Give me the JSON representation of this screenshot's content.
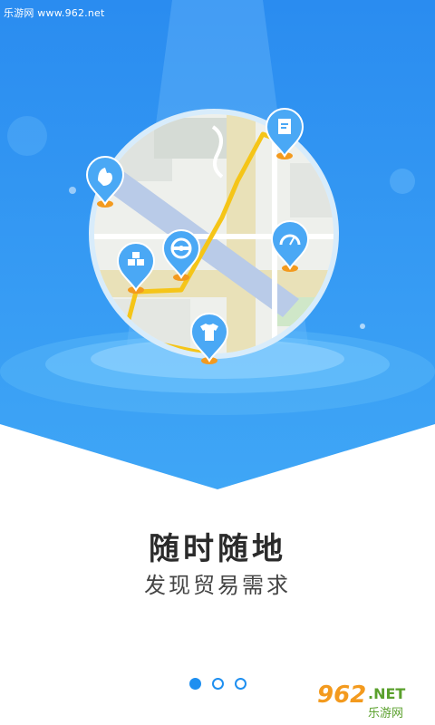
{
  "watermark": {
    "text": "乐游网 www.962.net"
  },
  "slide": {
    "title": "随时随地",
    "subtitle": "发现贸易需求"
  },
  "pager": {
    "total": 3,
    "active_index": 0
  },
  "brand": {
    "number": "962",
    "suffix": ".NET",
    "name": "乐游网"
  },
  "colors": {
    "brand_blue": "#1e8ff0",
    "route_yellow": "#f5c518",
    "pin_blue": "#4aa8f5",
    "pin_tip_orange": "#f39a1e"
  },
  "map_pins": [
    {
      "icon": "document-icon"
    },
    {
      "icon": "hand-icon"
    },
    {
      "icon": "gauge-icon"
    },
    {
      "icon": "steering-wheel-icon"
    },
    {
      "icon": "boxes-icon"
    },
    {
      "icon": "tshirt-icon"
    }
  ]
}
